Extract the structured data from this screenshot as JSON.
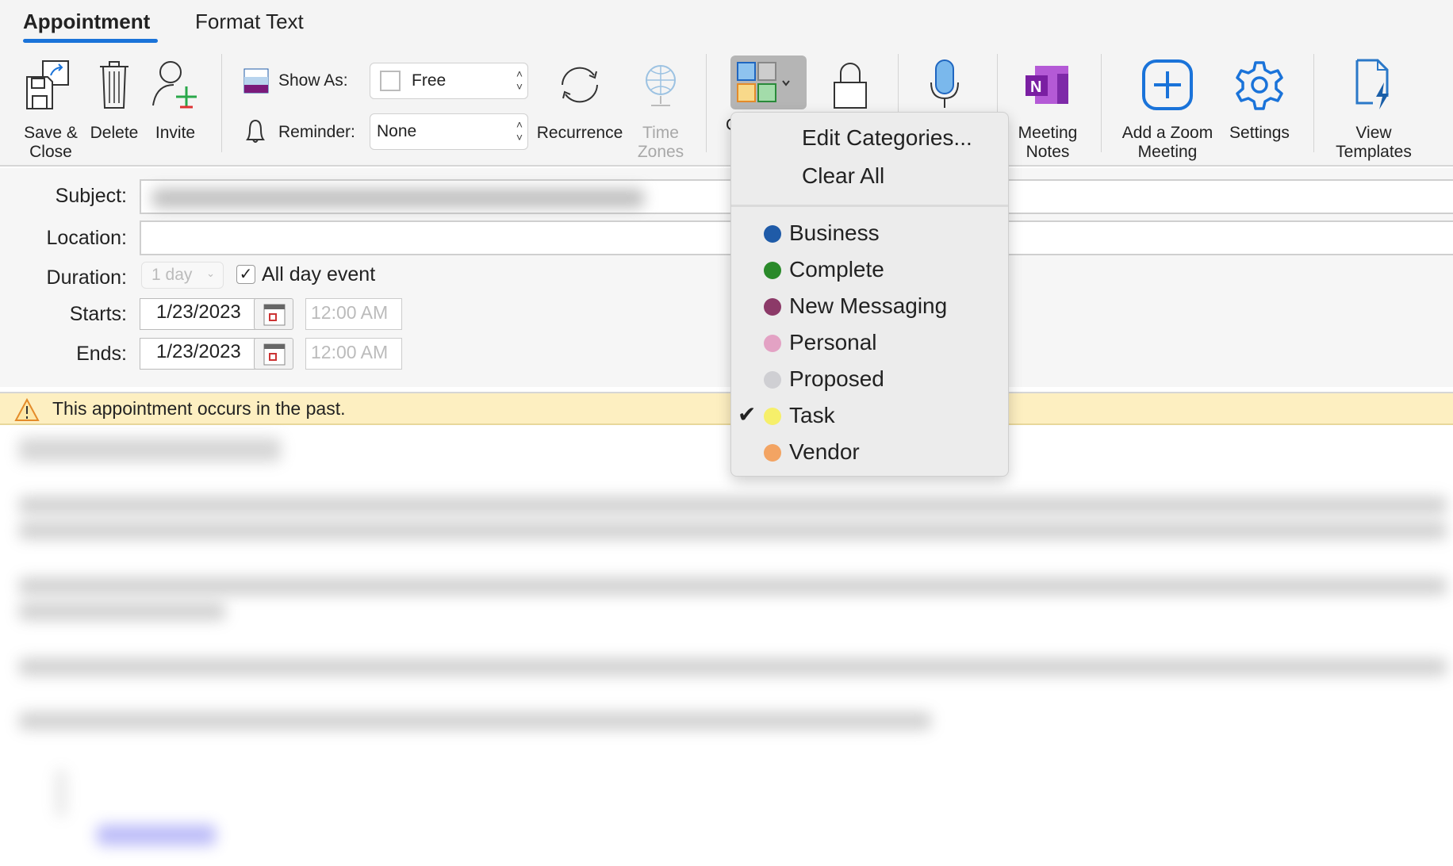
{
  "tabs": [
    {
      "label": "Appointment",
      "active": true
    },
    {
      "label": "Format Text",
      "active": false
    }
  ],
  "ribbon": {
    "save_close": "Save &\nClose",
    "delete": "Delete",
    "invite": "Invite",
    "show_as_label": "Show As:",
    "show_as_value": "Free",
    "reminder_label": "Reminder:",
    "reminder_value": "None",
    "recurrence": "Recurrence",
    "time_zones": "Time\nZones",
    "categorize_partial": "C",
    "meeting_notes": "Meeting\nNotes",
    "add_zoom": "Add a Zoom\nMeeting",
    "settings": "Settings",
    "view_templates": "View\nTemplates"
  },
  "form": {
    "subject_label": "Subject:",
    "location_label": "Location:",
    "location_value": "",
    "duration_label": "Duration:",
    "duration_value": "1 day",
    "all_day_label": "All day event",
    "all_day_checked": true,
    "starts_label": "Starts:",
    "starts_date": "1/23/2023",
    "starts_time": "12:00 AM",
    "ends_label": "Ends:",
    "ends_date": "1/23/2023",
    "ends_time": "12:00 AM"
  },
  "banner": {
    "text": "This appointment occurs in the past.",
    "icon": "warning-icon"
  },
  "category_menu": {
    "edit": "Edit Categories...",
    "clear": "Clear All",
    "items": [
      {
        "label": "Business",
        "color": "#1f5ba8",
        "checked": false
      },
      {
        "label": "Complete",
        "color": "#2a8a2a",
        "checked": false
      },
      {
        "label": "New Messaging",
        "color": "#8c3a68",
        "checked": false
      },
      {
        "label": "Personal",
        "color": "#e3a2c4",
        "checked": false
      },
      {
        "label": "Proposed",
        "color": "#cfcfd3",
        "checked": false
      },
      {
        "label": "Task",
        "color": "#f6ef6a",
        "checked": true
      },
      {
        "label": "Vendor",
        "color": "#f3a463",
        "checked": false
      }
    ]
  },
  "colors": {
    "accent": "#1a73d9",
    "banner": "#fdefc1"
  }
}
